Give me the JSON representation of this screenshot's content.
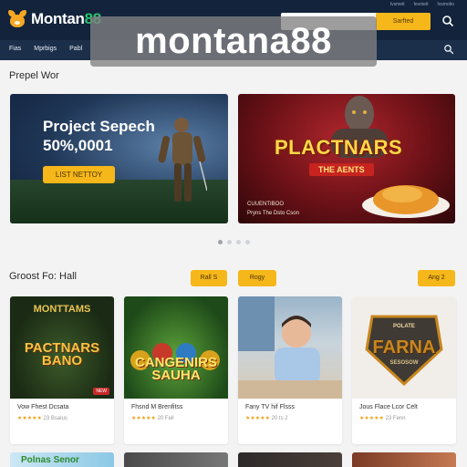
{
  "header": {
    "logo_text": "Montan",
    "logo_text_accent": "88",
    "top_links": [
      "Ivsmeti",
      "Ievnieit",
      "Ivsmotio"
    ],
    "search_button": "Sarfted",
    "watermark": "montana88"
  },
  "nav": {
    "items": [
      "Fias",
      "Mprbigs",
      "Pabl"
    ]
  },
  "featured": {
    "section_title": "Prepel Wor",
    "banners": [
      {
        "heading": "Project Sepech 50%,0001",
        "cta": "LIST NETTOY"
      },
      {
        "title": "PLACTNARS",
        "tag": "THE AENTS",
        "caption_1": "CUUENTIBOO",
        "caption_2": "Pryns The Dsto Cson"
      }
    ],
    "carousel_pages": 4,
    "carousel_active": 0
  },
  "games": {
    "section_title": "Groost Fo: Hall",
    "button_1": "Rall S",
    "button_2": "Rogy",
    "button_3": "Ang 2",
    "cards": [
      {
        "art_top": "MONTTAMS",
        "art_title": "PACTNARS BANO",
        "badge": "NEW",
        "name": "Vow Fhest Dcsata",
        "rating_stars": "★★★★★",
        "rating_text": "23 Bsalus"
      },
      {
        "art_title": "CANGENIRS SAUHA",
        "name": "Fhsnd M Brenfitss",
        "rating_stars": "★★★★★",
        "rating_text": "20 Feil"
      },
      {
        "name": "Fany TV hif Flsss",
        "rating_stars": "★★★★★",
        "rating_text": "20 ts 2"
      },
      {
        "art_title": "FARNA",
        "art_top": "POLATE",
        "art_bottom": "SESOSOW",
        "name": "Jous Flace Lcor Celt",
        "rating_stars": "★★★★★",
        "rating_text": "23 Fenn"
      }
    ],
    "next_row": [
      {
        "label": "Polnas Senor"
      }
    ]
  }
}
